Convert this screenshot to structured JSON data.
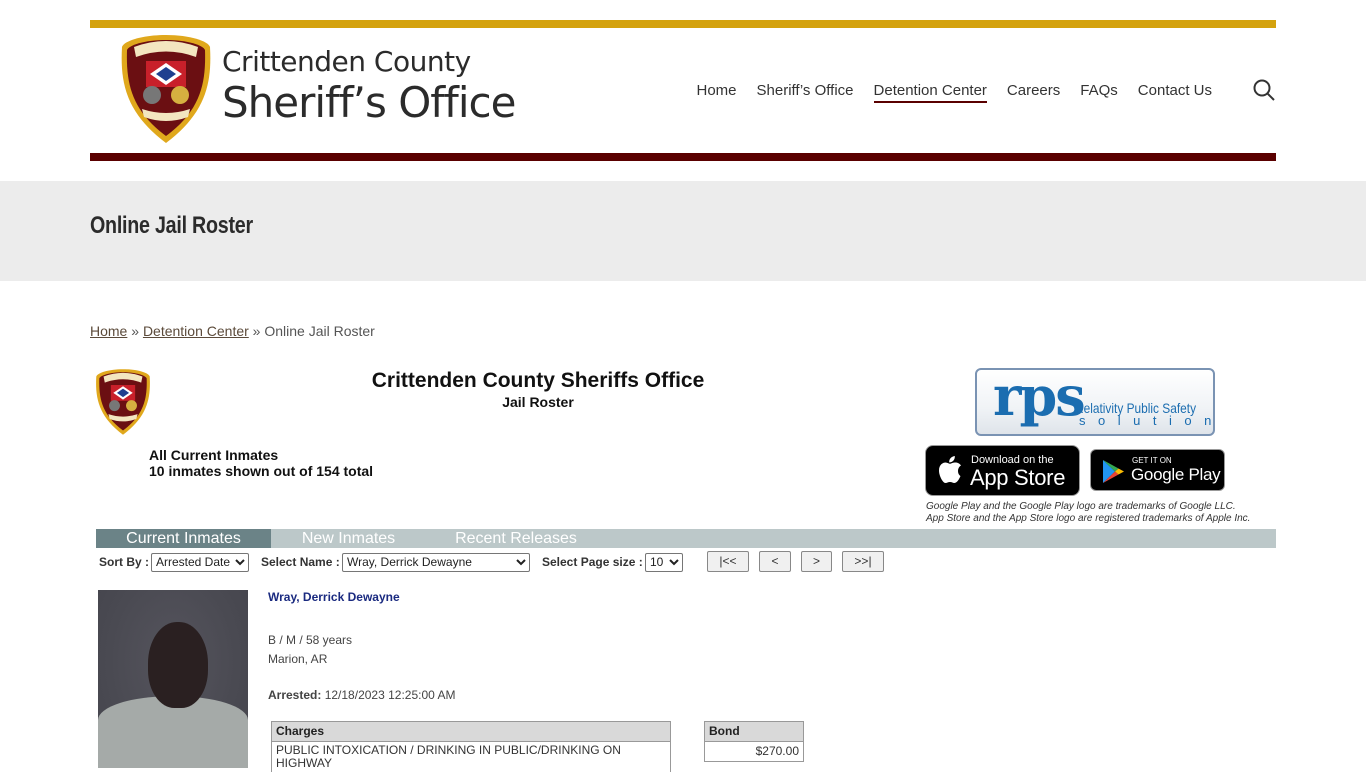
{
  "site": {
    "logo_line1": "Crittenden County",
    "logo_line2": "Sheriff’s Office",
    "brand_colors": {
      "gold": "#d4a20e",
      "maroon": "#5a0000"
    }
  },
  "nav": {
    "items": [
      {
        "label": "Home",
        "active": false
      },
      {
        "label": "Sheriff’s Office",
        "active": false
      },
      {
        "label": "Detention Center",
        "active": true
      },
      {
        "label": "Careers",
        "active": false
      },
      {
        "label": "FAQs",
        "active": false
      },
      {
        "label": "Contact Us",
        "active": false
      }
    ],
    "search_icon": "search-icon"
  },
  "page": {
    "title": "Online Jail Roster"
  },
  "breadcrumb": {
    "home": "Home",
    "sep1": " » ",
    "detention": "Detention Center",
    "sep2": " » ",
    "current": "Online Jail Roster"
  },
  "roster": {
    "org_title": "Crittenden County Sheriffs Office",
    "org_subtitle": "Jail Roster",
    "list_title": "All Current Inmates",
    "count_text": "10 inmates shown out of 154 total",
    "vendor": {
      "big": "rps",
      "line1": "Relativity Public Safety",
      "line2": "solutions"
    },
    "app_store": {
      "line1": "Download on the",
      "line2": "App Store"
    },
    "google_play": {
      "line1": "GET IT ON",
      "line2": "Google Play"
    },
    "trademark_line1": "Google Play and the Google Play logo are trademarks of Google LLC.",
    "trademark_line2": "App Store and the App Store logo are registered trademarks of Apple Inc.",
    "tabs": [
      {
        "label": "Current Inmates",
        "active": true
      },
      {
        "label": "New Inmates",
        "active": false
      },
      {
        "label": "Recent Releases",
        "active": false
      }
    ],
    "controls": {
      "sort_label": "Sort By :",
      "sort_value": "Arrested Date",
      "name_label": "Select Name :",
      "name_value": "Wray, Derrick Dewayne",
      "page_size_label": "Select Page size :",
      "page_size_value": "10",
      "first": "|<<",
      "prev": "<",
      "next": ">",
      "last": ">>|"
    },
    "inmate": {
      "name": "Wray, Derrick Dewayne",
      "demographics": "B / M / 58 years",
      "location": "Marion, AR",
      "arrested_label": "Arrested:",
      "arrested_value": "12/18/2023 12:25:00 AM",
      "charges_header": "Charges",
      "charges": [
        "PUBLIC INTOXICATION / DRINKING IN PUBLIC/DRINKING ON HIGHWAY"
      ],
      "bond_header": "Bond",
      "bonds": [
        "$270.00"
      ]
    }
  }
}
